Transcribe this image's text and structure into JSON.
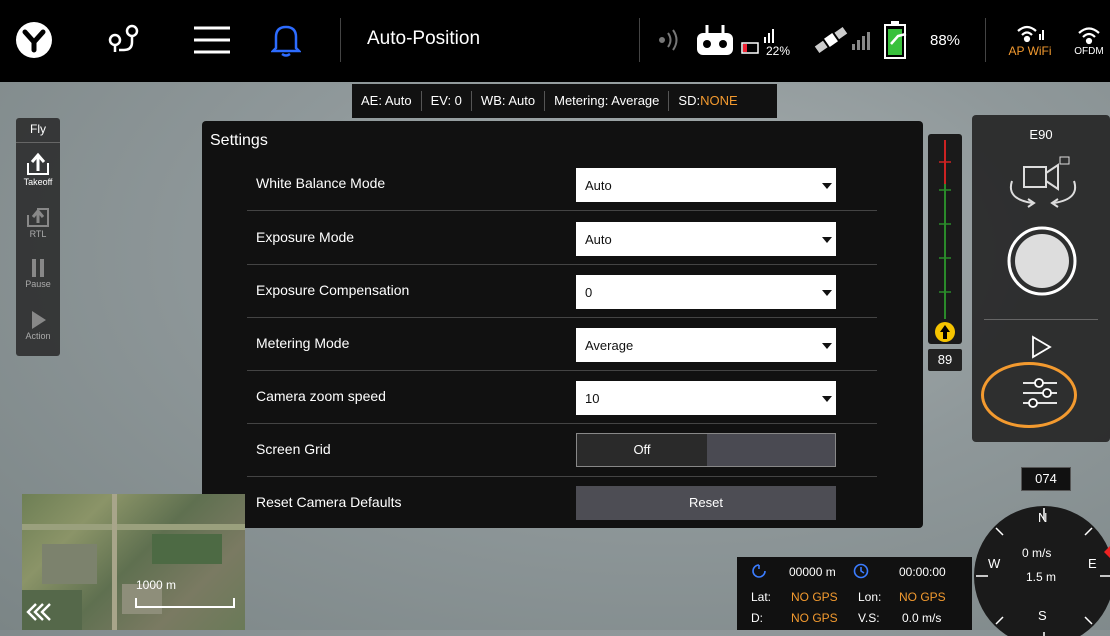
{
  "header": {
    "title": "Auto-Position",
    "controller_battery": "22%",
    "battery": "88%",
    "wifi_label": "AP WiFi",
    "ofdm_label": "OFDM"
  },
  "status": {
    "ae": "AE: Auto",
    "ev": "EV: 0",
    "wb": "WB: Auto",
    "metering": "Metering: Average",
    "sd_prefix": "SD:",
    "sd_value": "NONE"
  },
  "fly": {
    "title": "Fly",
    "buttons": [
      "Takeoff",
      "RTL",
      "Pause",
      "Action"
    ]
  },
  "settings": {
    "title": "Settings",
    "rows": [
      {
        "label": "White Balance Mode",
        "value": "Auto"
      },
      {
        "label": "Exposure Mode",
        "value": "Auto"
      },
      {
        "label": "Exposure Compensation",
        "value": "0"
      },
      {
        "label": "Metering Mode",
        "value": "Average"
      },
      {
        "label": "Camera zoom speed",
        "value": "10"
      }
    ],
    "grid_label": "Screen Grid",
    "grid_value": "Off",
    "reset_label": "Reset Camera Defaults",
    "reset_button": "Reset"
  },
  "altitude": {
    "value": "89"
  },
  "camera": {
    "model": "E90"
  },
  "map": {
    "scale": "1000 m"
  },
  "telemetry": {
    "distance": "00000 m",
    "time": "00:00:00",
    "lat_label": "Lat:",
    "lat": "NO GPS",
    "lon_label": "Lon:",
    "lon": "NO GPS",
    "d_label": "D:",
    "d": "NO GPS",
    "vs_label": "V.S:",
    "vs": "0.0 m/s"
  },
  "compass": {
    "heading": "074",
    "speed": "0 m/s",
    "alt": "1.5 m",
    "n": "N",
    "s": "S",
    "e": "E",
    "w": "W"
  },
  "colors": {
    "accent": "#f39a2f",
    "alt_yellow": "#f5c400"
  }
}
